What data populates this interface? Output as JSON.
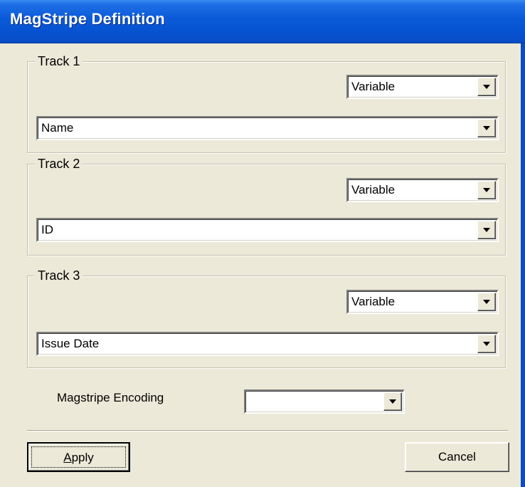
{
  "window": {
    "title": "MagStripe Definition"
  },
  "tracks": [
    {
      "label": "Track 1",
      "mode": "Variable",
      "field": "Name"
    },
    {
      "label": "Track 2",
      "mode": "Variable",
      "field": "ID"
    },
    {
      "label": "Track 3",
      "mode": "Variable",
      "field": "Issue Date"
    }
  ],
  "encoding": {
    "label": "Magstripe Encoding",
    "value": ""
  },
  "buttons": {
    "apply": {
      "label_accel": "A",
      "label_rest": "pply"
    },
    "cancel": "Cancel"
  },
  "icons": {
    "dropdown": "chevron-down-icon"
  }
}
